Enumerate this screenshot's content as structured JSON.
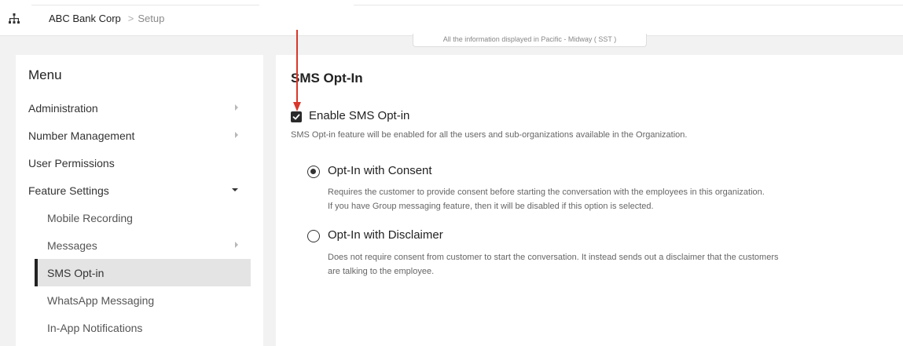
{
  "header": {
    "breadcrumb_org": "ABC Bank Corp",
    "breadcrumb_separator": ">",
    "breadcrumb_page": "Setup",
    "timezone_banner": "All the information displayed in Pacific - Midway ( SST )"
  },
  "sidebar": {
    "title": "Menu",
    "items": [
      {
        "label": "Administration"
      },
      {
        "label": "Number Management"
      },
      {
        "label": "User Permissions"
      },
      {
        "label": "Feature Settings"
      }
    ],
    "sub_items": [
      {
        "label": "Mobile Recording"
      },
      {
        "label": "Messages"
      },
      {
        "label": "SMS Opt-in"
      },
      {
        "label": "WhatsApp Messaging"
      },
      {
        "label": "In-App Notifications"
      }
    ]
  },
  "main": {
    "title": "SMS Opt-In",
    "enable": {
      "label": "Enable SMS Opt-in",
      "checked": true,
      "description": "SMS Opt-in feature will be enabled for all the users and sub-organizations available in the Organization."
    },
    "options": [
      {
        "label": "Opt-In with Consent",
        "selected": true,
        "desc_line1": "Requires the customer to provide consent before starting the conversation with the employees in this organization.",
        "desc_line2": "If you have Group messaging feature, then it will be disabled if this option is selected."
      },
      {
        "label": "Opt-In with Disclaimer",
        "selected": false,
        "desc_line1": "Does not require consent from customer to start the conversation. It instead sends out a disclaimer that the customers",
        "desc_line2": "are talking to the employee."
      }
    ]
  },
  "colors": {
    "annotation_arrow": "#d9372b",
    "active_indicator": "#222222",
    "active_background": "#e4e4e4"
  }
}
